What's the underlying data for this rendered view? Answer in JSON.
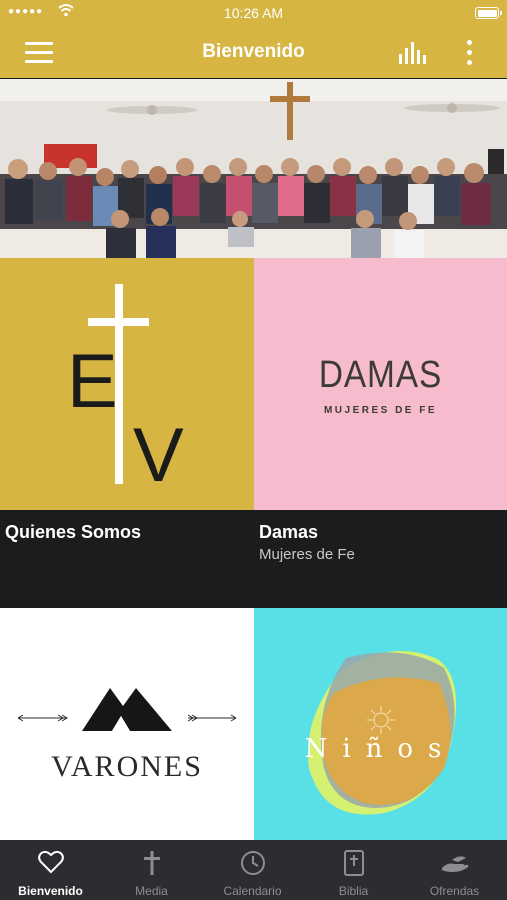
{
  "status_bar": {
    "time": "10:26 AM",
    "signal": "●●●●●"
  },
  "nav": {
    "title": "Bienvenido"
  },
  "tiles": [
    {
      "title": "Quienes Somos",
      "subtitle": "",
      "logo_text": [
        "E",
        "V"
      ]
    },
    {
      "title": "Damas",
      "subtitle": "Mujeres de Fe",
      "logo_text": [
        "DAMAS",
        "MUJERES DE FE"
      ]
    },
    {
      "logo_text": "VARONES"
    },
    {
      "logo_text": "Niños"
    }
  ],
  "tabs": [
    {
      "label": "Bienvenido",
      "icon": "heart-icon",
      "active": true
    },
    {
      "label": "Media",
      "icon": "cross-icon",
      "active": false
    },
    {
      "label": "Calendario",
      "icon": "clock-icon",
      "active": false
    },
    {
      "label": "Biblia",
      "icon": "bible-icon",
      "active": false
    },
    {
      "label": "Ofrendas",
      "icon": "offering-hand-icon",
      "active": false
    }
  ],
  "colors": {
    "accent": "#d6b543",
    "dark": "#1b1c1e",
    "pink": "#f6bccd",
    "cyan": "#58e0e6",
    "tabbar": "#2c2d30"
  }
}
